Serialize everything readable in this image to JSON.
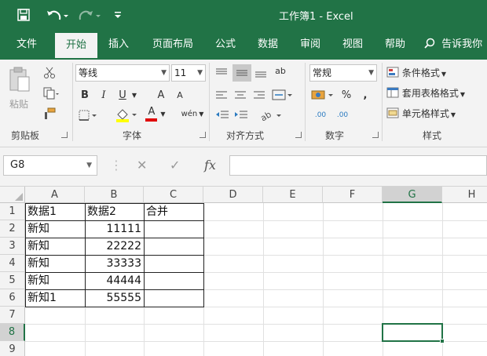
{
  "app": {
    "title": "工作簿1 - Excel",
    "accent_color": "#217346"
  },
  "quick_access": {
    "save_icon": "save-icon",
    "undo_icon": "undo-icon",
    "redo_icon": "redo-icon",
    "customize_icon": "customize-toolbar-icon"
  },
  "tabs": [
    {
      "label": "文件"
    },
    {
      "label": "开始"
    },
    {
      "label": "插入"
    },
    {
      "label": "页面布局"
    },
    {
      "label": "公式"
    },
    {
      "label": "数据"
    },
    {
      "label": "审阅"
    },
    {
      "label": "视图"
    },
    {
      "label": "帮助"
    }
  ],
  "active_tab": "开始",
  "tell_me": "告诉我你",
  "ribbon": {
    "clipboard": {
      "paste_label": "粘贴",
      "group_label": "剪贴板"
    },
    "font": {
      "font_name": "等线",
      "font_size": "11",
      "bold": "B",
      "italic": "I",
      "underline": "U",
      "grow": "A",
      "shrink": "A",
      "font_color_glyph": "A",
      "phonetic": "wén",
      "group_label": "字体"
    },
    "alignment": {
      "group_label": "对齐方式",
      "wrap_glyph": "ab"
    },
    "number": {
      "format": "常规",
      "percent": "%",
      "comma": ",",
      "inc_decimal": ".00",
      "dec_decimal": ".00",
      "group_label": "数字"
    },
    "styles": {
      "conditional": "条件格式",
      "table": "套用表格格式",
      "cell_styles": "单元格样式",
      "group_label": "样式"
    }
  },
  "formula_bar": {
    "name_box": "G8",
    "cancel_glyph": "✕",
    "enter_glyph": "✓",
    "fx_glyph": "fx",
    "formula": ""
  },
  "sheet": {
    "columns": [
      "A",
      "B",
      "C",
      "D",
      "E",
      "F",
      "G",
      "H"
    ],
    "selected_column": "G",
    "rows": [
      "1",
      "2",
      "3",
      "4",
      "5",
      "6",
      "7",
      "8",
      "9"
    ],
    "selected_row": "8",
    "active_cell": "G8",
    "cells": {
      "A1": "数据1",
      "B1": "数据2",
      "C1": "合并",
      "A2": "新知",
      "B2": "11111",
      "A3": "新知",
      "B3": "22222",
      "A4": "新知",
      "B4": "33333",
      "A5": "新知",
      "B5": "44444",
      "A6": "新知1",
      "B6": "55555"
    }
  }
}
